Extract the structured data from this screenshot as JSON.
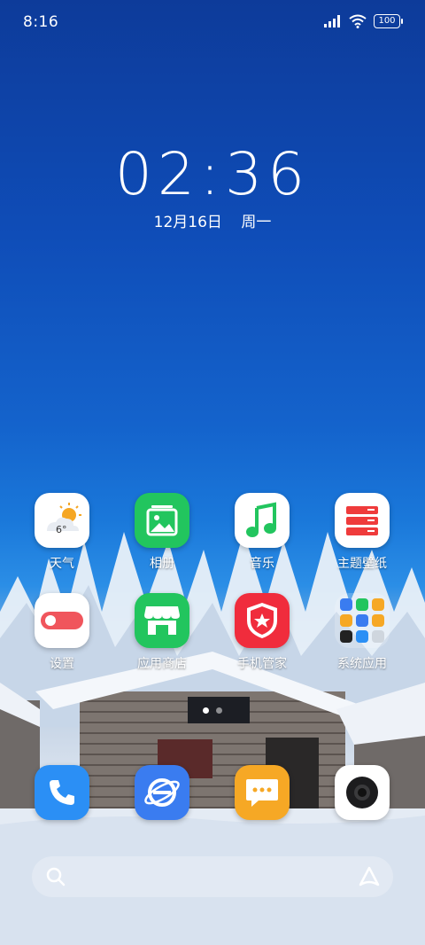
{
  "status_bar": {
    "time": "8:16",
    "battery": "100"
  },
  "clock": {
    "time": "02:36",
    "date": "12月16日",
    "weekday": "周一"
  },
  "apps": [
    {
      "label": "天气",
      "badge": "6°"
    },
    {
      "label": "相册"
    },
    {
      "label": "音乐"
    },
    {
      "label": "主题壁纸"
    },
    {
      "label": "设置"
    },
    {
      "label": "应用商店"
    },
    {
      "label": "手机管家"
    },
    {
      "label": "系统应用"
    }
  ],
  "dock": [
    "phone",
    "browser",
    "messages",
    "camera"
  ],
  "colors": {
    "weather_bg": "#ffffff",
    "gallery": "#22c55e",
    "music_bg": "#ffffff",
    "theme_bg": "#ffffff",
    "theme_accent": "#ef3b3b",
    "settings_bg": "#ffffff",
    "settings_accent": "#f0555c",
    "store": "#22c55e",
    "security": "#f02c3c",
    "phone": "#2b8ff5",
    "browser": "#3a7cf0",
    "messages": "#f6a825",
    "camera": "#ffffff"
  }
}
